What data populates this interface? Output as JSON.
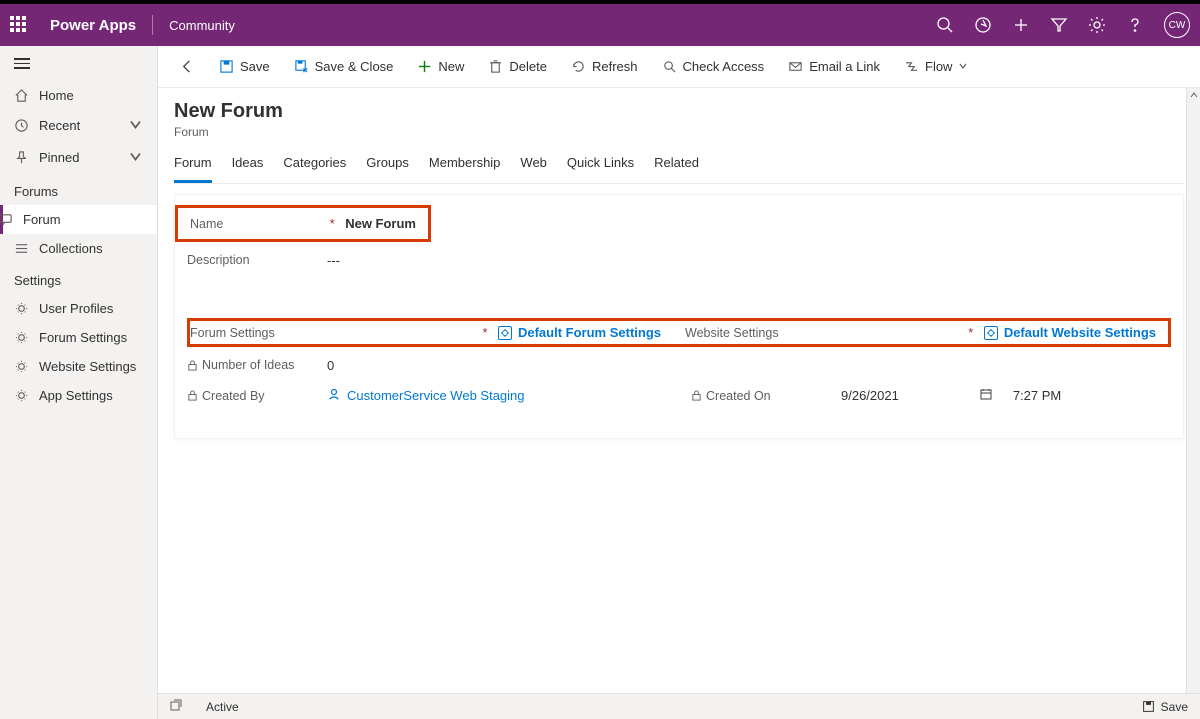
{
  "header": {
    "brand": "Power Apps",
    "subbrand": "Community",
    "avatar_initials": "CW"
  },
  "leftnav": {
    "home": "Home",
    "recent": "Recent",
    "pinned": "Pinned",
    "section1": "Forums",
    "forum": "Forum",
    "collections": "Collections",
    "section2": "Settings",
    "user_profiles": "User Profiles",
    "forum_settings": "Forum Settings",
    "website_settings": "Website Settings",
    "app_settings": "App Settings"
  },
  "cmdbar": {
    "save": "Save",
    "save_close": "Save & Close",
    "new": "New",
    "delete": "Delete",
    "refresh": "Refresh",
    "check_access": "Check Access",
    "email_link": "Email a Link",
    "flow": "Flow"
  },
  "page": {
    "title": "New Forum",
    "subtitle": "Forum"
  },
  "tabs": {
    "forum": "Forum",
    "ideas": "Ideas",
    "categories": "Categories",
    "groups": "Groups",
    "membership": "Membership",
    "web": "Web",
    "quick_links": "Quick Links",
    "related": "Related"
  },
  "form": {
    "name_label": "Name",
    "name_value": "New Forum",
    "description_label": "Description",
    "description_value": "---",
    "forum_settings_label": "Forum Settings",
    "forum_settings_value": "Default Forum Settings",
    "website_settings_label": "Website Settings",
    "website_settings_value": "Default Website Settings",
    "number_ideas_label": "Number of Ideas",
    "number_ideas_value": "0",
    "created_by_label": "Created By",
    "created_by_value": "CustomerService Web Staging",
    "created_on_label": "Created On",
    "created_on_date": "9/26/2021",
    "created_on_time": "7:27 PM"
  },
  "footer": {
    "status": "Active",
    "save": "Save"
  }
}
